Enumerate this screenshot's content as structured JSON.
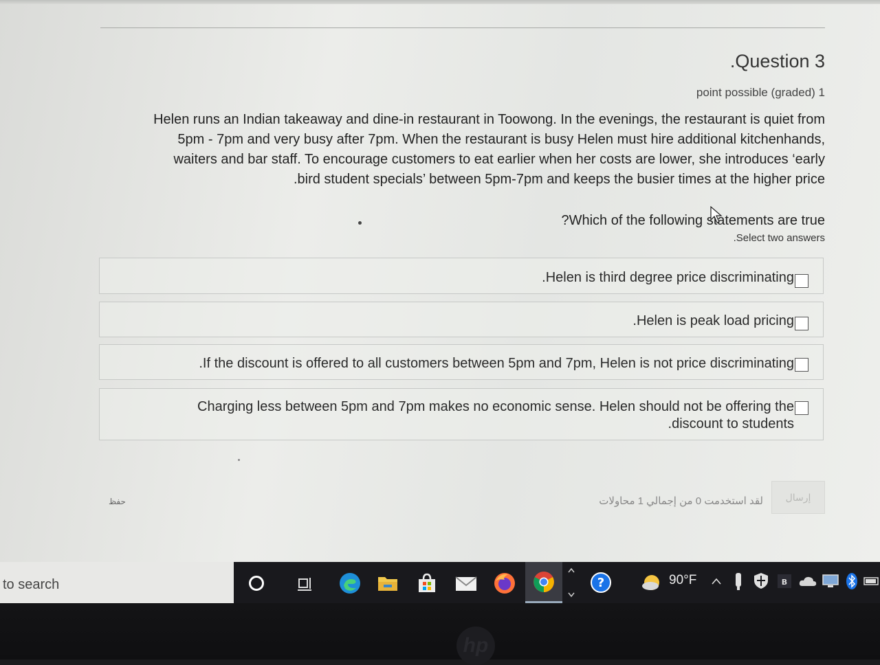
{
  "question": {
    "title": ".Question 3",
    "points": "point possible (graded) 1",
    "lines": [
      "Helen runs an Indian takeaway and dine-in restaurant in Toowong. In the evenings, the restaurant is quiet from",
      "5pm - 7pm and very busy after 7pm. When the restaurant is busy Helen must hire additional kitchenhands,",
      "waiters and bar staff. To encourage customers to eat earlier when her costs are lower, she introduces ‘early",
      ".bird student specials’ between 5pm-7pm and keeps the busier times at the higher price"
    ],
    "prompt": "?Which of the following statements are true",
    "instruction": ".Select two answers"
  },
  "options": [
    {
      "lines": [
        ".Helen is third degree price discriminating"
      ],
      "checked": false
    },
    {
      "lines": [
        ".Helen is peak load pricing"
      ],
      "checked": false
    },
    {
      "lines": [
        ".If the discount is offered to all customers between 5pm and 7pm, Helen is not price discriminating"
      ],
      "checked": false
    },
    {
      "lines": [
        "Charging less between 5pm and 7pm makes no economic sense. Helen should not be offering the",
        ".discount to students"
      ],
      "checked": false
    }
  ],
  "footer": {
    "submit_label": "إرسال",
    "attempts_text": "لقد استخدمت 0 من إجمالي 1 محاولات",
    "save_label": "حفظ"
  },
  "taskbar": {
    "search_text": "to search",
    "weather_temp": "90°F",
    "icons": [
      "cortana-icon",
      "task-view-icon",
      "edge-icon",
      "file-explorer-icon",
      "store-icon",
      "mail-icon",
      "firefox-icon",
      "chrome-icon",
      "help-icon"
    ],
    "tray_icons": [
      "weather-icon",
      "chevron-up-icon",
      "usb-icon",
      "security-icon",
      "bb-icon",
      "onedrive-icon",
      "display-icon",
      "bluetooth-icon",
      "battery-icon"
    ]
  },
  "colors": {
    "background": "#e6e8e5",
    "text": "#222222",
    "taskbar": "#19191d"
  }
}
